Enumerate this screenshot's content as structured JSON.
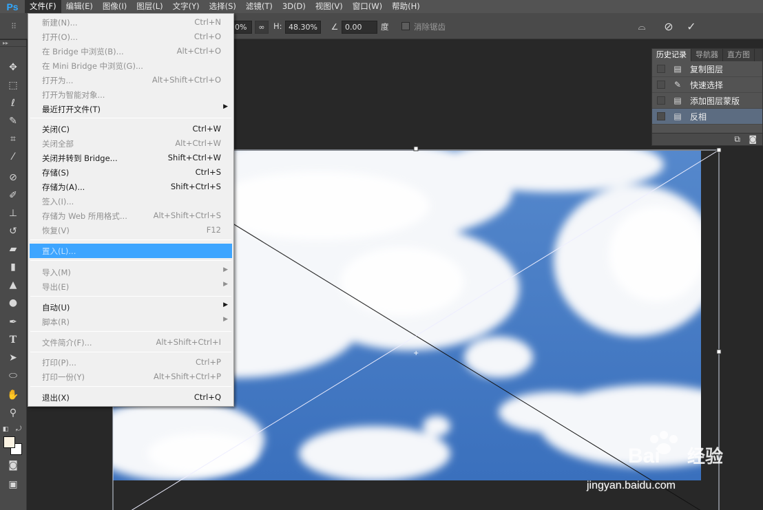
{
  "app": {
    "logo": "Ps"
  },
  "menubar": [
    {
      "label": "文件(F)"
    },
    {
      "label": "编辑(E)"
    },
    {
      "label": "图像(I)"
    },
    {
      "label": "图层(L)"
    },
    {
      "label": "文字(Y)"
    },
    {
      "label": "选择(S)"
    },
    {
      "label": "滤镜(T)"
    },
    {
      "label": "3D(D)"
    },
    {
      "label": "视图(V)"
    },
    {
      "label": "窗口(W)"
    },
    {
      "label": "帮助(H)"
    }
  ],
  "options": {
    "w_value": "0%",
    "h_label": "H:",
    "h_value": "48.30%",
    "angle_value": "0.00",
    "angle_unit": "度",
    "antialias_label": "消除锯齿"
  },
  "history_panel": {
    "tabs": [
      {
        "label": "历史记录"
      },
      {
        "label": "导航器"
      },
      {
        "label": "直方图"
      }
    ],
    "items": [
      {
        "label": "复制图层",
        "icon": "document-icon"
      },
      {
        "label": "快速选择",
        "icon": "quick-select-brush-icon"
      },
      {
        "label": "添加图层蒙版",
        "icon": "document-icon"
      },
      {
        "label": "反相",
        "icon": "document-icon"
      }
    ]
  },
  "file_menu": {
    "items": [
      {
        "label": "新建(N)...",
        "shortcut": "Ctrl+N",
        "disabled": true
      },
      {
        "label": "打开(O)...",
        "shortcut": "Ctrl+O",
        "disabled": true
      },
      {
        "label": "在 Bridge 中浏览(B)...",
        "shortcut": "Alt+Ctrl+O",
        "disabled": true
      },
      {
        "label": "在 Mini Bridge 中浏览(G)...",
        "shortcut": "",
        "disabled": true
      },
      {
        "label": "打开为...",
        "shortcut": "Alt+Shift+Ctrl+O",
        "disabled": true
      },
      {
        "label": "打开为智能对象...",
        "shortcut": "",
        "disabled": true
      },
      {
        "label": "最近打开文件(T)",
        "shortcut": "",
        "disabled": false,
        "submenu": true
      },
      {
        "label": "关闭(C)",
        "shortcut": "Ctrl+W",
        "disabled": false
      },
      {
        "label": "关闭全部",
        "shortcut": "Alt+Ctrl+W",
        "disabled": true
      },
      {
        "label": "关闭并转到 Bridge...",
        "shortcut": "Shift+Ctrl+W",
        "disabled": false
      },
      {
        "label": "存储(S)",
        "shortcut": "Ctrl+S",
        "disabled": false
      },
      {
        "label": "存储为(A)...",
        "shortcut": "Shift+Ctrl+S",
        "disabled": false
      },
      {
        "label": "签入(I)...",
        "shortcut": "",
        "disabled": true
      },
      {
        "label": "存储为 Web 所用格式...",
        "shortcut": "Alt+Shift+Ctrl+S",
        "disabled": true
      },
      {
        "label": "恢复(V)",
        "shortcut": "F12",
        "disabled": true
      },
      {
        "label": "置入(L)...",
        "shortcut": "",
        "disabled": true,
        "highlighted": true
      },
      {
        "label": "导入(M)",
        "shortcut": "",
        "disabled": true,
        "submenu": true
      },
      {
        "label": "导出(E)",
        "shortcut": "",
        "disabled": true,
        "submenu": true
      },
      {
        "label": "自动(U)",
        "shortcut": "",
        "disabled": false,
        "submenu": true
      },
      {
        "label": "脚本(R)",
        "shortcut": "",
        "disabled": true,
        "submenu": true
      },
      {
        "label": "文件简介(F)...",
        "shortcut": "Alt+Shift+Ctrl+I",
        "disabled": true
      },
      {
        "label": "打印(P)...",
        "shortcut": "Ctrl+P",
        "disabled": true
      },
      {
        "label": "打印一份(Y)",
        "shortcut": "Alt+Shift+Ctrl+P",
        "disabled": true
      },
      {
        "label": "退出(X)",
        "shortcut": "Ctrl+Q",
        "disabled": false
      }
    ]
  },
  "watermark": {
    "url": "jingyan.baidu.com"
  }
}
